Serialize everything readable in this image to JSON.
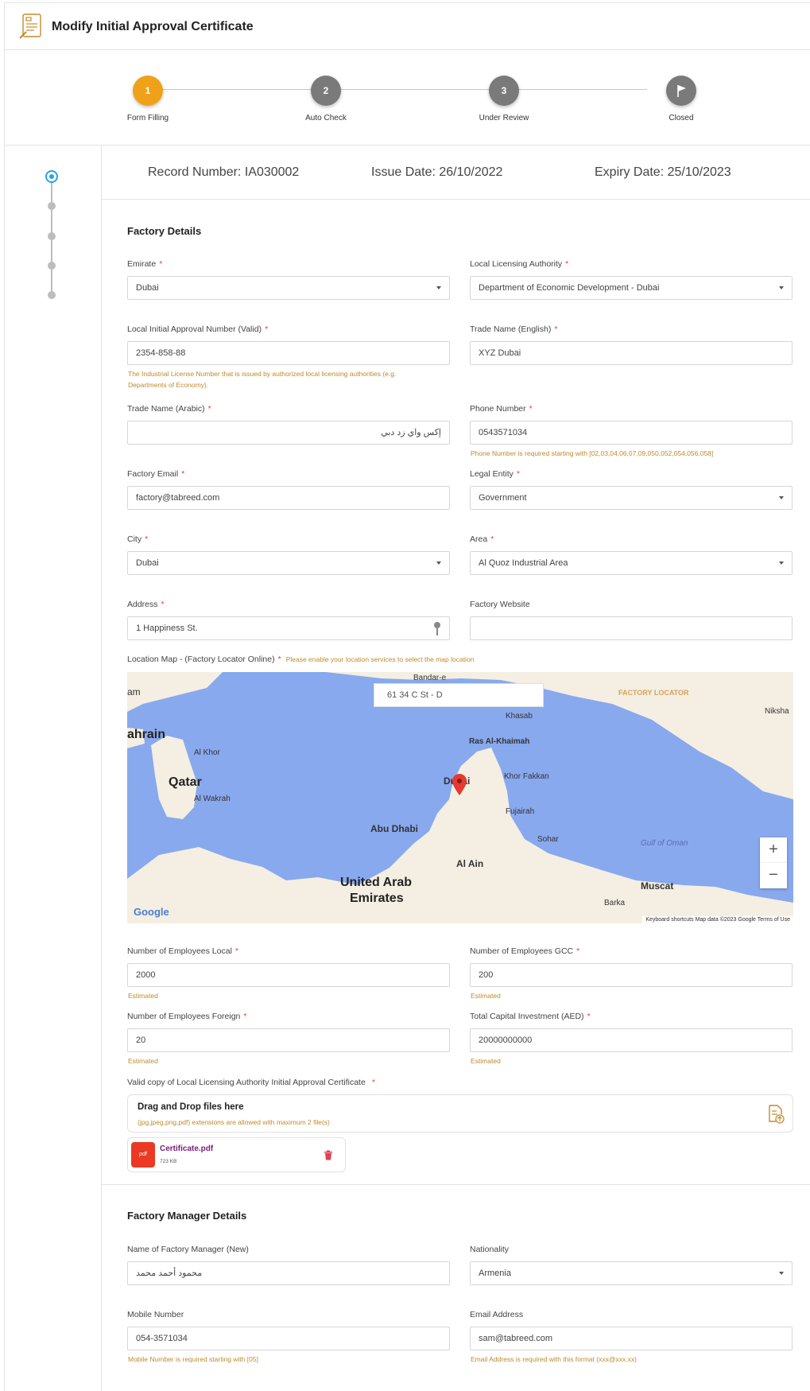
{
  "page": {
    "title": "Modify Initial Approval Certificate"
  },
  "steps": [
    {
      "number": "1",
      "label": "Form Filling"
    },
    {
      "number": "2",
      "label": "Auto Check"
    },
    {
      "number": "3",
      "label": "Under Review"
    },
    {
      "number": "",
      "label": "Closed"
    }
  ],
  "record": {
    "record_number": "Record Number: IA030002",
    "issue_date": "Issue Date: 26/10/2022",
    "expiry_date": "Expiry Date: 25/10/2023"
  },
  "factory": {
    "section_title": "Factory Details",
    "emirate": {
      "label": "Emirate",
      "value": "Dubai"
    },
    "licensing_authority": {
      "label": "Local Licensing Authority",
      "value": "Department of Economic Development - Dubai"
    },
    "approval_number": {
      "label": "Local Initial Approval Number (Valid)",
      "value": "2354-858-88",
      "hint_line1": "The Industrial License Number that is issued by authorized local licensing authorities (e.g.",
      "hint_line2": "Departments of Economy)."
    },
    "trade_name_en": {
      "label": "Trade Name (English)",
      "value": "XYZ Dubai"
    },
    "trade_name_ar": {
      "label": "Trade Name (Arabic)",
      "value": "إكس واي زد دبي"
    },
    "phone": {
      "label": "Phone Number",
      "value": "0543571034",
      "hint": "Phone Number is required starting with [02,03,04,06,07,09,050,052,054,056,058]"
    },
    "email": {
      "label": "Factory Email",
      "value": "factory@tabreed.com"
    },
    "legal_entity": {
      "label": "Legal Entity",
      "value": "Government"
    },
    "city": {
      "label": "City",
      "value": "Dubai"
    },
    "area": {
      "label": "Area",
      "value": "Al Quoz Industrial Area"
    },
    "address": {
      "label": "Address",
      "value": "1 Happiness St."
    },
    "website": {
      "label": "Factory Website",
      "value": ""
    },
    "map": {
      "label": "Location Map - (Factory Locator Online)",
      "hint": "Please enable your location services to select the map location",
      "search_value": "61 34 C St - D",
      "watermark": "FACTORY LOCATOR",
      "places": {
        "bandar": "Bandar-e",
        "am": "am",
        "bahrain": "ahrain",
        "al_khor": "Al Khor",
        "qatar": "Qatar",
        "al_wakrah": "Al Wakrah",
        "khasab": "Khasab",
        "ras_al_khaimah": "Ras Al-Khaimah",
        "khor_fakkan": "Khor Fakkan",
        "dubai": "Dubai",
        "fujairah": "Fujairah",
        "abu_dhabi": "Abu Dhabi",
        "sohar": "Sohar",
        "gulf_of_oman": "Gulf of Oman",
        "al_ain": "Al Ain",
        "uae_line1": "United Arab",
        "uae_line2": "Emirates",
        "muscat": "Muscat",
        "barka": "Barka",
        "niksha": "Niksha"
      },
      "google": "Google",
      "footer": "Keyboard shortcuts   Map data ©2023 Google   Terms of Use",
      "zoom_in": "+",
      "zoom_out": "−"
    },
    "employees_local": {
      "label": "Number of Employees Local",
      "value": "2000",
      "hint": "Estimated"
    },
    "employees_gcc": {
      "label": "Number of Employees GCC",
      "value": "200",
      "hint": "Estimated"
    },
    "employees_foreign": {
      "label": "Number of Employees Foreign",
      "value": "20",
      "hint": "Estimated"
    },
    "capital": {
      "label": "Total Capital Investment (AED)",
      "value": "20000000000",
      "hint": "Estimated"
    },
    "certificate": {
      "label": "Valid copy of Local Licensing Authority Initial Approval Certificate",
      "drop_title": "Drag and Drop files here",
      "drop_hint": "(jpg,jpeg,png,pdf) extensions are allowed with maximum 2 file(s)",
      "file_name": "Certificate.pdf",
      "file_size": "723 KB",
      "file_type": "pdf"
    }
  },
  "manager": {
    "section_title": "Factory Manager Details",
    "name": {
      "label": "Name of Factory Manager (New)",
      "value": "محمود أحمد محمد"
    },
    "nationality": {
      "label": "Nationality",
      "value": "Armenia"
    },
    "mobile": {
      "label": "Mobile Number",
      "value": "054-3571034",
      "hint": "Mobile Number is required starting with [05]"
    },
    "email": {
      "label": "Email Address",
      "value": "sam@tabreed.com",
      "hint": "Email Address is required with this format (xxx@xxx.xx)"
    }
  },
  "required_mark": "*",
  "colors": {
    "accent": "#f0a11a",
    "step_inactive": "#7a7a7a",
    "rail_active": "#29a3dd",
    "required": "#e0414f",
    "hint": "#c08a2a"
  }
}
